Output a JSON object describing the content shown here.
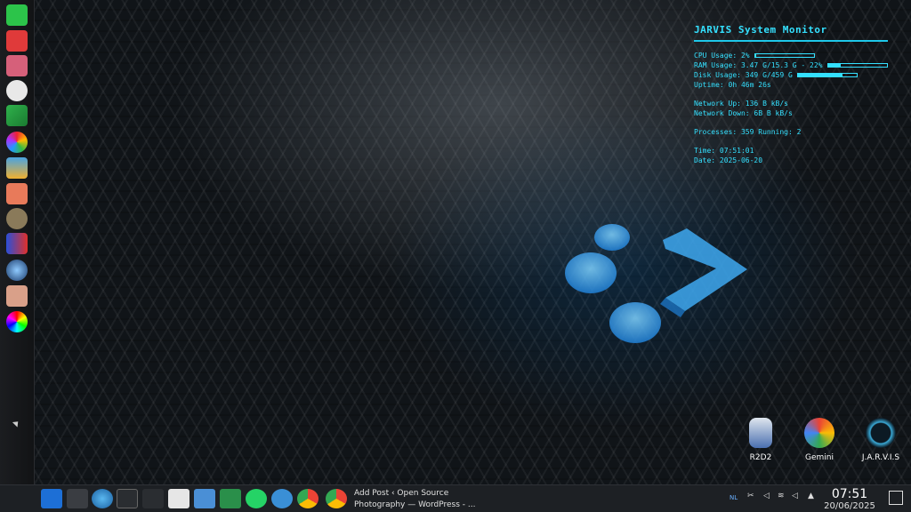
{
  "conky": {
    "title": "JARVIS System Monitor",
    "cpu": "CPU Usage: 2%",
    "cpu_pct": 2,
    "ram": "RAM Usage: 3.47 G/15.3 G - 22%",
    "ram_pct": 22,
    "disk": "Disk Usage: 349 G/459 G",
    "disk_pct": 76,
    "uptime": "Uptime: 0h 46m 26s",
    "net_up": "Network Up: 136 B kB/s",
    "net_down": "Network Down: 6B B kB/s",
    "processes": "Processes: 359  Running: 2",
    "time": "Time: 07:51:01",
    "date": "Date: 2025-06-20"
  },
  "desktop_icons": [
    {
      "label": "R2D2",
      "icon": "r2d2-icon"
    },
    {
      "label": "Gemini",
      "icon": "gemini-icon"
    },
    {
      "label": "J.A.R.V.I.S",
      "icon": "jarvis-icon"
    }
  ],
  "dock_icons": [
    "sync-green-icon",
    "sync-red-icon",
    "camera-icon",
    "aperture-icon",
    "photo-icon",
    "colorwheel-icon",
    "image-viewer-icon",
    "paint-icon",
    "gimp-icon",
    "stack-icon",
    "lens-icon",
    "eye-icon",
    "color-picker-icon"
  ],
  "taskbar": {
    "task_window_line1": "Add Post ‹ Open Source",
    "task_window_line2": "Photography — WordPress - ...",
    "tray_keyboard": "NL",
    "clock_time": "07:51",
    "clock_date": "20/06/2025"
  },
  "colors": {
    "accent": "#34e0ff",
    "taskbar": "#1d2024"
  }
}
